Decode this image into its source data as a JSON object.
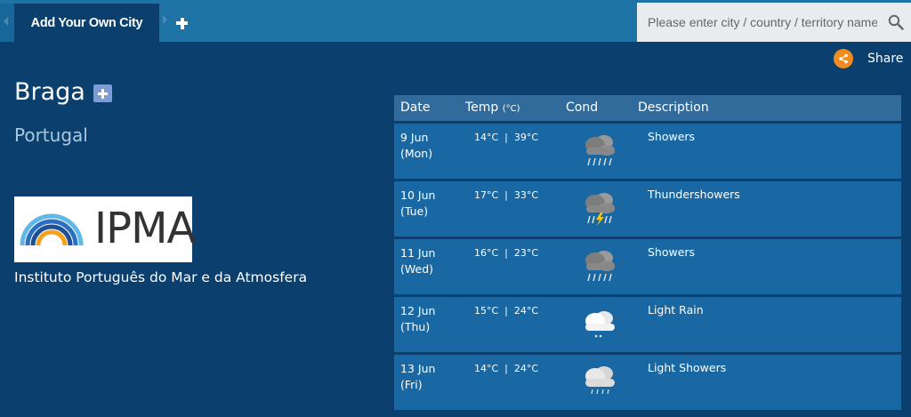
{
  "tabs": {
    "active_label": "Add Your Own City"
  },
  "search": {
    "placeholder": "Please enter city / country / territory name"
  },
  "share": {
    "label": "Share"
  },
  "city": {
    "name": "Braga",
    "country": "Portugal"
  },
  "provider": {
    "logo_text": "IPMA",
    "name": "Instituto Português do Mar e da Atmosfera"
  },
  "forecast": {
    "headers": {
      "date": "Date",
      "temp": "Temp",
      "temp_unit": "(°C)",
      "cond": "Cond",
      "description": "Description"
    },
    "rows": [
      {
        "date": "9 Jun",
        "day": "(Mon)",
        "temp": "14°C  |  39°C",
        "icon": "showers-icon",
        "description": "Showers"
      },
      {
        "date": "10 Jun",
        "day": "(Tue)",
        "temp": "17°C  |  33°C",
        "icon": "thundershowers-icon",
        "description": "Thundershowers"
      },
      {
        "date": "11 Jun",
        "day": "(Wed)",
        "temp": "16°C  |  23°C",
        "icon": "showers-icon",
        "description": "Showers"
      },
      {
        "date": "12 Jun",
        "day": "(Thu)",
        "temp": "15°C  |  24°C",
        "icon": "light-rain-icon",
        "description": "Light Rain"
      },
      {
        "date": "13 Jun",
        "day": "(Fri)",
        "temp": "14°C  |  24°C",
        "icon": "light-showers-icon",
        "description": "Light Showers"
      }
    ]
  },
  "colors": {
    "background": "#0b3f6e",
    "topbar": "#1e73a5",
    "row": "#1968a3",
    "header": "#316b9c",
    "share_accent": "#f28c1e",
    "country_text": "#a9c8e2"
  }
}
